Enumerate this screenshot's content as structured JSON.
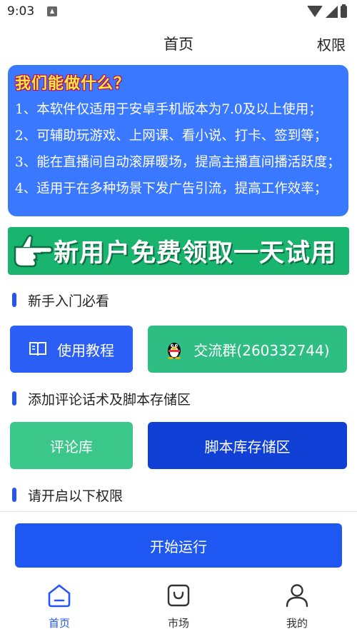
{
  "status_bar": {
    "time": "9:03"
  },
  "header": {
    "title": "首页",
    "right_link": "权限"
  },
  "info_card": {
    "title": "我们能做什么？",
    "lines": [
      "1、本软件仅适用于安卓手机版本为7.0及以上使用；",
      "2、可辅助玩游戏、上网课、看小说、打卡、签到等；",
      "3、能在直播间自动滚屏暖场，提高主播直间播活跃度；",
      "4、适用于在多种场景下发广告引流，提高工作效率；"
    ]
  },
  "banner": {
    "text": "新用户免费领取一天试用"
  },
  "sections": {
    "guide": "新手入门必看",
    "storage": "添加评论话术及脚本存储区",
    "permissions": "请开启以下权限"
  },
  "buttons": {
    "tutorial": "使用教程",
    "group": "交流群(260332744)",
    "comments": "评论库",
    "scripts": "脚本库存储区",
    "start": "开始运行"
  },
  "nav": [
    {
      "label": "首页",
      "icon": "home-icon",
      "active": true
    },
    {
      "label": "市场",
      "icon": "shopping-bag-icon",
      "active": false
    },
    {
      "label": "我的",
      "icon": "user-icon",
      "active": false
    }
  ],
  "colors": {
    "accent": "#2356f5",
    "card_blue": "#3a78ff",
    "banner_green": "#19b46e",
    "button_green": "#2ebe83",
    "title_yellow": "#ffeb3b"
  }
}
